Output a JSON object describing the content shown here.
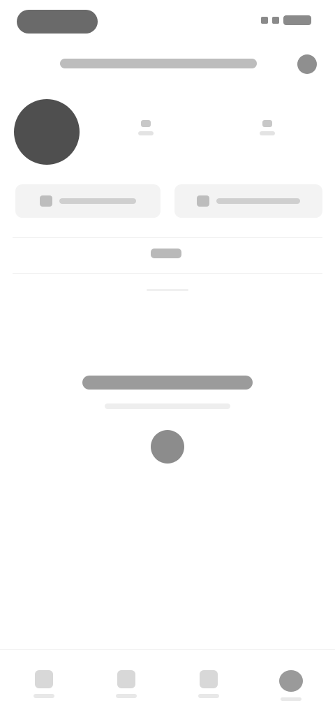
{
  "app": {
    "title": ""
  },
  "status_bar": {
    "time": "",
    "icons": [
      "signal-icon",
      "wifi-icon",
      "battery-icon"
    ]
  },
  "header": {
    "username": "",
    "menu_icon": "menu-icon"
  },
  "profile": {
    "avatar": "avatar",
    "stats": [
      {
        "value": "",
        "label": ""
      },
      {
        "value": "",
        "label": ""
      }
    ]
  },
  "actions": [
    {
      "label": "",
      "icon": "edit-icon"
    },
    {
      "label": "",
      "icon": "share-icon"
    }
  ],
  "tabs": [
    {
      "label": "",
      "icon": "grid-icon",
      "active": true
    }
  ],
  "empty_state": {
    "title": "",
    "subtitle": "",
    "icon": "camera-icon"
  },
  "bottom_nav": [
    {
      "label": "",
      "icon": "home-icon"
    },
    {
      "label": "",
      "icon": "search-icon"
    },
    {
      "label": "",
      "icon": "add-icon"
    },
    {
      "label": "",
      "icon": "profile-icon",
      "active": true
    }
  ],
  "colors": {
    "avatar": "#4f4f4f",
    "background": "#ffffff",
    "accent": "#8c8c8c"
  }
}
